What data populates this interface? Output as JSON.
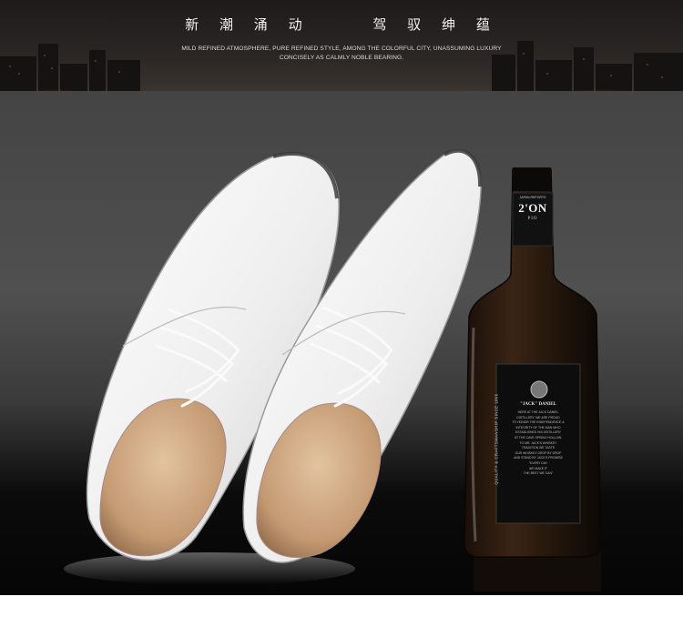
{
  "banner": {
    "title": "新 潮 涌 动     驾 驭 绅 蕴",
    "subtitle_line1": "MILD REFINED ATMOSPHERE, PURE REFINED STYLE, AMONG THE COLORFUL CITY, UNASSUMING LUXURY",
    "subtitle_line2": "CONCISELY AS CALMLY NOBLE BEARING."
  },
  "bottle": {
    "label_top": "2'ON",
    "label_sub": "PIO",
    "label_small": "JAPAN REPORTS",
    "label_name": "\"JACK\" DANIEL",
    "label_lines": [
      "HERE AT THE JACK DANIEL",
      "DISTILLERY, WE ARE PROUD",
      "TO HONOR THE INDEPENDENCE &",
      "INTEGRITY OF THE MAN WHO",
      "ESTABLISHED HIS DISTILLERY",
      "AT THE CAVE SPRING HOLLOW.",
      "TO MR. JACK'S WHISKEY",
      "TRADITION WE TASTE",
      "OUR WHISKEY DROP BY DROP",
      "AND STAND BY JACK'S PROMISE",
      "\"EVERY DAY",
      "WE MAKE IT",
      "THE BEST WE CAN\""
    ],
    "side_text": "QUALITY & CRAFTSMANSHIP SINCE 1866"
  },
  "colors": {
    "banner_bg": "#1d1b1a",
    "table_bg": "#050505",
    "wall_bg": "#4a4a4a",
    "shoe_white": "#f4f4f4",
    "lining_tan": "#c9a27d"
  }
}
